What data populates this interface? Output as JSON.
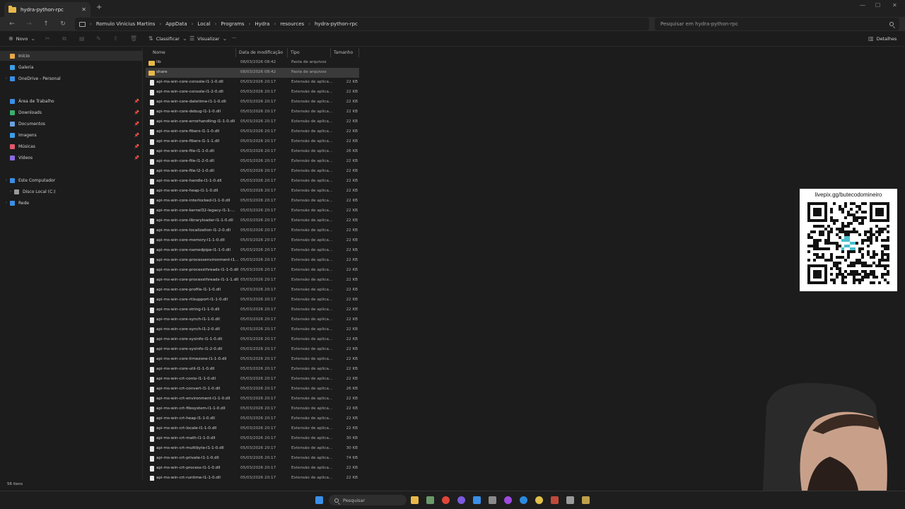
{
  "window": {
    "tab_title": "hydra-python-rpc",
    "new_tab": "+",
    "close": "✕"
  },
  "breadcrumb": [
    "Romulo Vinicius Martins",
    "AppData",
    "Local",
    "Programs",
    "Hydra",
    "resources",
    "hydra-python-rpc"
  ],
  "search": {
    "placeholder": "Pesquisar em hydra-python-rpc"
  },
  "commands": {
    "new": "Novo",
    "sort": "Classificar",
    "view": "Visualizar",
    "more": "···",
    "details": "Detalhes"
  },
  "sidebar": {
    "items": [
      {
        "label": "Início",
        "icon": "home-icon",
        "color": "#e8a94a"
      },
      {
        "label": "Galeria",
        "icon": "gallery-icon",
        "color": "#3aa0e8"
      },
      {
        "label": "OneDrive - Personal",
        "icon": "onedrive-icon",
        "color": "#3a8fe8"
      },
      {
        "label": "Área de Trabalho",
        "icon": "desktop-icon",
        "color": "#3a8fe8"
      },
      {
        "label": "Downloads",
        "icon": "downloads-icon",
        "color": "#3ab06a"
      },
      {
        "label": "Documentos",
        "icon": "documents-icon",
        "color": "#6a9fe0"
      },
      {
        "label": "Imagens",
        "icon": "pictures-icon",
        "color": "#3a9ee8"
      },
      {
        "label": "Músicas",
        "icon": "music-icon",
        "color": "#e05a6a"
      },
      {
        "label": "Vídeos",
        "icon": "videos-icon",
        "color": "#8a6ae0"
      },
      {
        "label": "Este Computador",
        "icon": "computer-icon",
        "color": "#3a8fe8"
      },
      {
        "label": "Disco Local (C:)",
        "icon": "drive-icon",
        "color": "#9a9a9a"
      },
      {
        "label": "Rede",
        "icon": "network-icon",
        "color": "#3a8fe8"
      }
    ]
  },
  "columns": {
    "name": "Nome",
    "date": "Data de modificação",
    "type": "Tipo",
    "size": "Tamanho"
  },
  "files": [
    {
      "name": "lib",
      "date": "08/03/2026 08:42",
      "type": "Pasta de arquivos",
      "size": "",
      "folder": true
    },
    {
      "name": "share",
      "date": "08/03/2026 08:42",
      "type": "Pasta de arquivos",
      "size": "",
      "folder": true
    },
    {
      "name": "api-ms-win-core-console-l1-1-0.dll",
      "date": "05/03/2026 20:17",
      "type": "Extensão de aplica...",
      "size": "22 KB"
    },
    {
      "name": "api-ms-win-core-console-l1-2-0.dll",
      "date": "05/03/2026 20:17",
      "type": "Extensão de aplica...",
      "size": "22 KB"
    },
    {
      "name": "api-ms-win-core-datetime-l1-1-0.dll",
      "date": "05/03/2026 20:17",
      "type": "Extensão de aplica...",
      "size": "22 KB"
    },
    {
      "name": "api-ms-win-core-debug-l1-1-0.dll",
      "date": "05/03/2026 20:17",
      "type": "Extensão de aplica...",
      "size": "22 KB"
    },
    {
      "name": "api-ms-win-core-errorhandling-l1-1-0.dll",
      "date": "05/03/2026 20:17",
      "type": "Extensão de aplica...",
      "size": "22 KB"
    },
    {
      "name": "api-ms-win-core-fibers-l1-1-0.dll",
      "date": "05/03/2026 20:17",
      "type": "Extensão de aplica...",
      "size": "22 KB"
    },
    {
      "name": "api-ms-win-core-fibers-l1-1-1.dll",
      "date": "05/03/2026 20:17",
      "type": "Extensão de aplica...",
      "size": "22 KB"
    },
    {
      "name": "api-ms-win-core-file-l1-1-0.dll",
      "date": "05/03/2026 20:17",
      "type": "Extensão de aplica...",
      "size": "26 KB"
    },
    {
      "name": "api-ms-win-core-file-l1-2-0.dll",
      "date": "05/03/2026 20:17",
      "type": "Extensão de aplica...",
      "size": "22 KB"
    },
    {
      "name": "api-ms-win-core-file-l2-1-0.dll",
      "date": "05/03/2026 20:17",
      "type": "Extensão de aplica...",
      "size": "22 KB"
    },
    {
      "name": "api-ms-win-core-handle-l1-1-0.dll",
      "date": "05/03/2026 20:17",
      "type": "Extensão de aplica...",
      "size": "22 KB"
    },
    {
      "name": "api-ms-win-core-heap-l1-1-0.dll",
      "date": "05/03/2026 20:17",
      "type": "Extensão de aplica...",
      "size": "22 KB"
    },
    {
      "name": "api-ms-win-core-interlocked-l1-1-0.dll",
      "date": "05/03/2026 20:17",
      "type": "Extensão de aplica...",
      "size": "22 KB"
    },
    {
      "name": "api-ms-win-core-kernel32-legacy-l1-1-...",
      "date": "05/03/2026 20:17",
      "type": "Extensão de aplica...",
      "size": "22 KB"
    },
    {
      "name": "api-ms-win-core-libraryloader-l1-1-0.dll",
      "date": "05/03/2026 20:17",
      "type": "Extensão de aplica...",
      "size": "22 KB"
    },
    {
      "name": "api-ms-win-core-localization-l1-2-0.dll",
      "date": "05/03/2026 20:17",
      "type": "Extensão de aplica...",
      "size": "22 KB"
    },
    {
      "name": "api-ms-win-core-memory-l1-1-0.dll",
      "date": "05/03/2026 20:17",
      "type": "Extensão de aplica...",
      "size": "22 KB"
    },
    {
      "name": "api-ms-win-core-namedpipe-l1-1-0.dll",
      "date": "05/03/2026 20:17",
      "type": "Extensão de aplica...",
      "size": "22 KB"
    },
    {
      "name": "api-ms-win-core-processenvironment-l1...",
      "date": "05/03/2026 20:17",
      "type": "Extensão de aplica...",
      "size": "22 KB"
    },
    {
      "name": "api-ms-win-core-processthreads-l1-1-0.dll",
      "date": "05/03/2026 20:17",
      "type": "Extensão de aplica...",
      "size": "22 KB"
    },
    {
      "name": "api-ms-win-core-processthreads-l1-1-1.dll",
      "date": "05/03/2026 20:17",
      "type": "Extensão de aplica...",
      "size": "22 KB"
    },
    {
      "name": "api-ms-win-core-profile-l1-1-0.dll",
      "date": "05/03/2026 20:17",
      "type": "Extensão de aplica...",
      "size": "22 KB"
    },
    {
      "name": "api-ms-win-core-rtlsupport-l1-1-0.dll",
      "date": "05/03/2026 20:17",
      "type": "Extensão de aplica...",
      "size": "22 KB"
    },
    {
      "name": "api-ms-win-core-string-l1-1-0.dll",
      "date": "05/03/2026 20:17",
      "type": "Extensão de aplica...",
      "size": "22 KB"
    },
    {
      "name": "api-ms-win-core-synch-l1-1-0.dll",
      "date": "05/03/2026 20:17",
      "type": "Extensão de aplica...",
      "size": "22 KB"
    },
    {
      "name": "api-ms-win-core-synch-l1-2-0.dll",
      "date": "05/03/2026 20:17",
      "type": "Extensão de aplica...",
      "size": "22 KB"
    },
    {
      "name": "api-ms-win-core-sysinfo-l1-1-0.dll",
      "date": "05/03/2026 20:17",
      "type": "Extensão de aplica...",
      "size": "22 KB"
    },
    {
      "name": "api-ms-win-core-sysinfo-l1-2-0.dll",
      "date": "05/03/2026 20:17",
      "type": "Extensão de aplica...",
      "size": "22 KB"
    },
    {
      "name": "api-ms-win-core-timezone-l1-1-0.dll",
      "date": "05/03/2026 20:17",
      "type": "Extensão de aplica...",
      "size": "22 KB"
    },
    {
      "name": "api-ms-win-core-util-l1-1-0.dll",
      "date": "05/03/2026 20:17",
      "type": "Extensão de aplica...",
      "size": "22 KB"
    },
    {
      "name": "api-ms-win-crt-conio-l1-1-0.dll",
      "date": "05/03/2026 20:17",
      "type": "Extensão de aplica...",
      "size": "22 KB"
    },
    {
      "name": "api-ms-win-crt-convert-l1-1-0.dll",
      "date": "05/03/2026 20:17",
      "type": "Extensão de aplica...",
      "size": "26 KB"
    },
    {
      "name": "api-ms-win-crt-environment-l1-1-0.dll",
      "date": "05/03/2026 20:17",
      "type": "Extensão de aplica...",
      "size": "22 KB"
    },
    {
      "name": "api-ms-win-crt-filesystem-l1-1-0.dll",
      "date": "05/03/2026 20:17",
      "type": "Extensão de aplica...",
      "size": "22 KB"
    },
    {
      "name": "api-ms-win-crt-heap-l1-1-0.dll",
      "date": "05/03/2026 20:17",
      "type": "Extensão de aplica...",
      "size": "22 KB"
    },
    {
      "name": "api-ms-win-crt-locale-l1-1-0.dll",
      "date": "05/03/2026 20:17",
      "type": "Extensão de aplica...",
      "size": "22 KB"
    },
    {
      "name": "api-ms-win-crt-math-l1-1-0.dll",
      "date": "05/03/2026 20:17",
      "type": "Extensão de aplica...",
      "size": "30 KB"
    },
    {
      "name": "api-ms-win-crt-multibyte-l1-1-0.dll",
      "date": "05/03/2026 20:17",
      "type": "Extensão de aplica...",
      "size": "30 KB"
    },
    {
      "name": "api-ms-win-crt-private-l1-1-0.dll",
      "date": "05/03/2026 20:17",
      "type": "Extensão de aplica...",
      "size": "74 KB"
    },
    {
      "name": "api-ms-win-crt-process-l1-1-0.dll",
      "date": "05/03/2026 20:17",
      "type": "Extensão de aplica...",
      "size": "22 KB"
    },
    {
      "name": "api-ms-win-crt-runtime-l1-1-0.dll",
      "date": "05/03/2026 20:17",
      "type": "Extensão de aplica...",
      "size": "22 KB"
    }
  ],
  "status": {
    "items": "56 itens"
  },
  "taskbar": {
    "search_label": "Pesquisar"
  },
  "overlay": {
    "qr_label": "livepix.gg/butecodomineiro"
  },
  "colors": {
    "background": "#1c1c1c",
    "selection": "#3a3a3a",
    "folder": "#e8b84a"
  }
}
